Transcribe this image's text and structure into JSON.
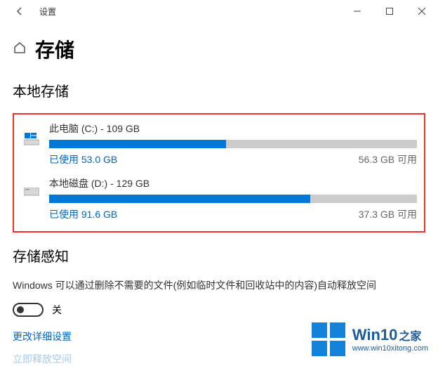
{
  "titlebar": {
    "title": "设置"
  },
  "header": {
    "title": "存储"
  },
  "local_storage": {
    "section_title": "本地存储",
    "disks": [
      {
        "title": "此电脑 (C:) - 109 GB",
        "used_label": "已使用 53.0 GB",
        "free_label": "56.3 GB 可用",
        "used_pct": 48,
        "is_system": true
      },
      {
        "title": "本地磁盘 (D:) - 129 GB",
        "used_label": "已使用 91.6 GB",
        "free_label": "37.3 GB 可用",
        "used_pct": 71,
        "is_system": false
      }
    ]
  },
  "storage_sense": {
    "section_title": "存储感知",
    "description": "Windows 可以通过删除不需要的文件(例如临时文件和回收站中的内容)自动释放空间",
    "toggle_label": "关",
    "change_detailed": "更改详细设置",
    "release_now": "立即释放空间"
  },
  "watermark": {
    "brand": "Win10",
    "brand_suffix": "之家",
    "url": "www.win10xitong.com"
  }
}
